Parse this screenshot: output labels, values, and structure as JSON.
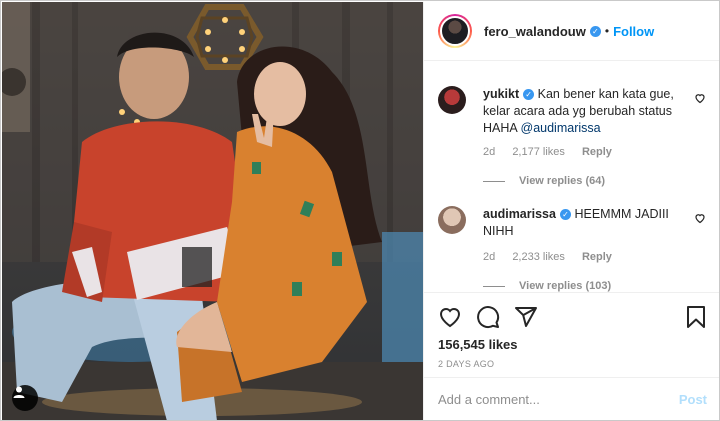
{
  "post": {
    "username": "fero_walandouw",
    "separator": "•",
    "follow_label": "Follow",
    "likes": "156,545 likes",
    "time_ago": "2 DAYS AGO"
  },
  "comments": [
    {
      "username": "yukikt",
      "text": "Kan bener kan kata gue, kelar acara ada yg berubah status HAHA ",
      "mention": "@audimarissa",
      "age": "2d",
      "likes": "2,177 likes",
      "reply_label": "Reply",
      "view_replies": "View replies (64)"
    },
    {
      "username": "audimarissa",
      "text": "HEEMMM JADIII NIHH",
      "age": "2d",
      "likes": "2,233 likes",
      "reply_label": "Reply",
      "view_replies": "View replies (103)"
    }
  ],
  "composer": {
    "placeholder": "Add a comment...",
    "post_label": "Post"
  },
  "colors": {
    "accent": "#0095f6",
    "verified": "#3897f0",
    "muted": "#8e8e8e",
    "post_disabled": "#b2dffc"
  },
  "icons": [
    "verified-badge-icon",
    "heart-icon",
    "comment-icon",
    "share-icon",
    "bookmark-icon",
    "user-tag-icon"
  ]
}
